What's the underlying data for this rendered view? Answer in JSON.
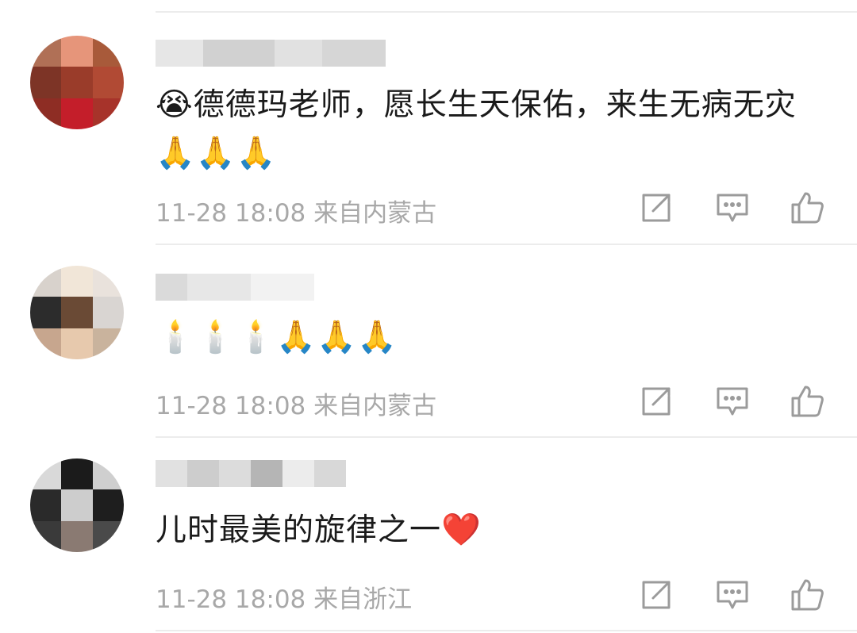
{
  "comments": [
    {
      "text_prefix_emoji": "😭",
      "text": "德德玛老师，愿长生天保佑，来生无病无灾",
      "text_suffix_emoji": "🙏🙏🙏",
      "time": "11-28 18:08",
      "location": "来自内蒙古"
    },
    {
      "text_prefix_emoji": "",
      "text": "",
      "text_suffix_emoji": "🕯️🕯️🕯️🙏🙏🙏",
      "time": "11-28 18:08",
      "location": "来自内蒙古"
    },
    {
      "text_prefix_emoji": "",
      "text": "儿时最美的旋律之一",
      "text_suffix_emoji": "❤️",
      "time": "11-28 18:08",
      "location": "来自浙江"
    }
  ],
  "icons": [
    "share-icon",
    "comment-icon",
    "like-icon"
  ],
  "colors": {
    "meta_text": "#a8a8a8",
    "icon": "#9b9b9b",
    "divider": "#ececec"
  }
}
